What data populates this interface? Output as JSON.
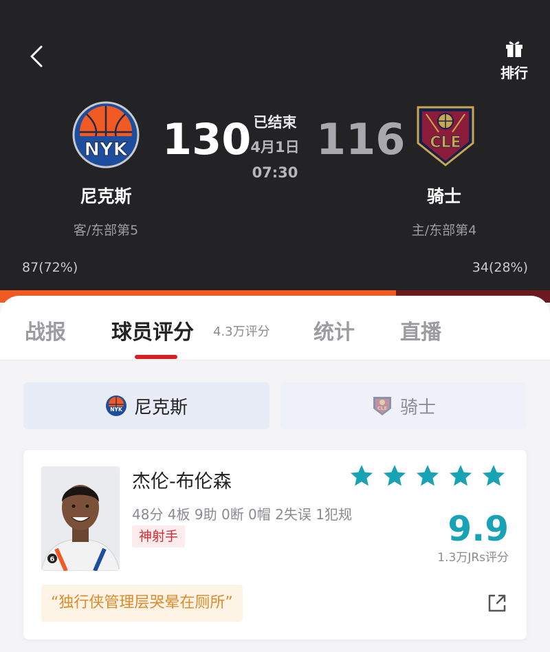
{
  "header": {
    "back_icon": "chevron-left-icon",
    "rank_icon": "gift-icon",
    "rank_label": "排行"
  },
  "game": {
    "home_team": {
      "abbr": "NYK",
      "name": "尼克斯",
      "rank": "客/东部第5",
      "score": "130",
      "vote": "87(72%)",
      "vote_fraction": 0.72,
      "logo_color": "#f15a22"
    },
    "away_team": {
      "abbr": "CLE",
      "name": "骑士",
      "rank": "主/东部第4",
      "score": "116",
      "vote": "34(28%)",
      "logo_color": "#8b1c3a"
    },
    "status": "已结束",
    "date": "4月1日",
    "time": "07:30"
  },
  "tabs": {
    "report": "战报",
    "ratings": "球员评分",
    "ratings_count": "4.3万评分",
    "stats": "统计",
    "live": "直播"
  },
  "team_switch": {
    "home_label": "尼克斯",
    "away_label": "骑士"
  },
  "player": {
    "name": "杰伦-布伦森",
    "stats": "48分 4板 9助 0断 0帽 2失误 1犯规",
    "tag": "神射手",
    "stars": 5,
    "score": "9.9",
    "rating_count": "1.3万JRs评分",
    "quote": "“独行侠管理层哭晕在厕所”",
    "jersey_number": "6",
    "accent_color": "#17a3b5"
  }
}
